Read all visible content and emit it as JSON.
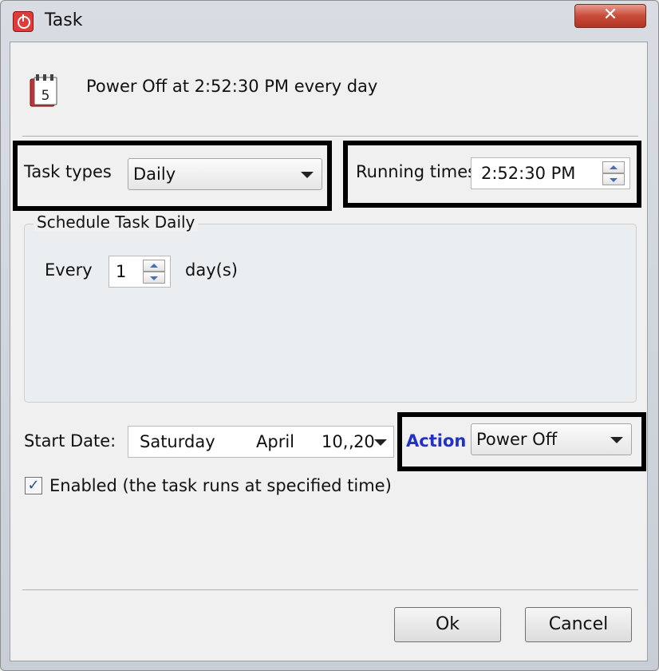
{
  "window": {
    "title": "Task",
    "close_glyph": "✕"
  },
  "summary": {
    "text": "Power Off at 2:52:30 PM every day",
    "icon_glyph": "5"
  },
  "task_types": {
    "label": "Task types",
    "value": "Daily"
  },
  "running_times": {
    "label": "Running times",
    "value": "2:52:30 PM"
  },
  "schedule": {
    "title": "Schedule Task Daily",
    "every_label": "Every",
    "every_value": "1",
    "unit_label": "day(s)"
  },
  "start_date": {
    "label": "Start Date:",
    "weekday": "Saturday",
    "separator": ",",
    "month": "April",
    "day_year": "10, 20"
  },
  "action": {
    "label": "Action",
    "value": "Power Off"
  },
  "enabled": {
    "checked_glyph": "✓",
    "label": "Enabled (the task runs at specified time)"
  },
  "buttons": {
    "ok": "Ok",
    "cancel": "Cancel"
  },
  "colors": {
    "action_label": "#2330c8",
    "close_button": "#c84b3a",
    "highlight_border": "#000000"
  }
}
